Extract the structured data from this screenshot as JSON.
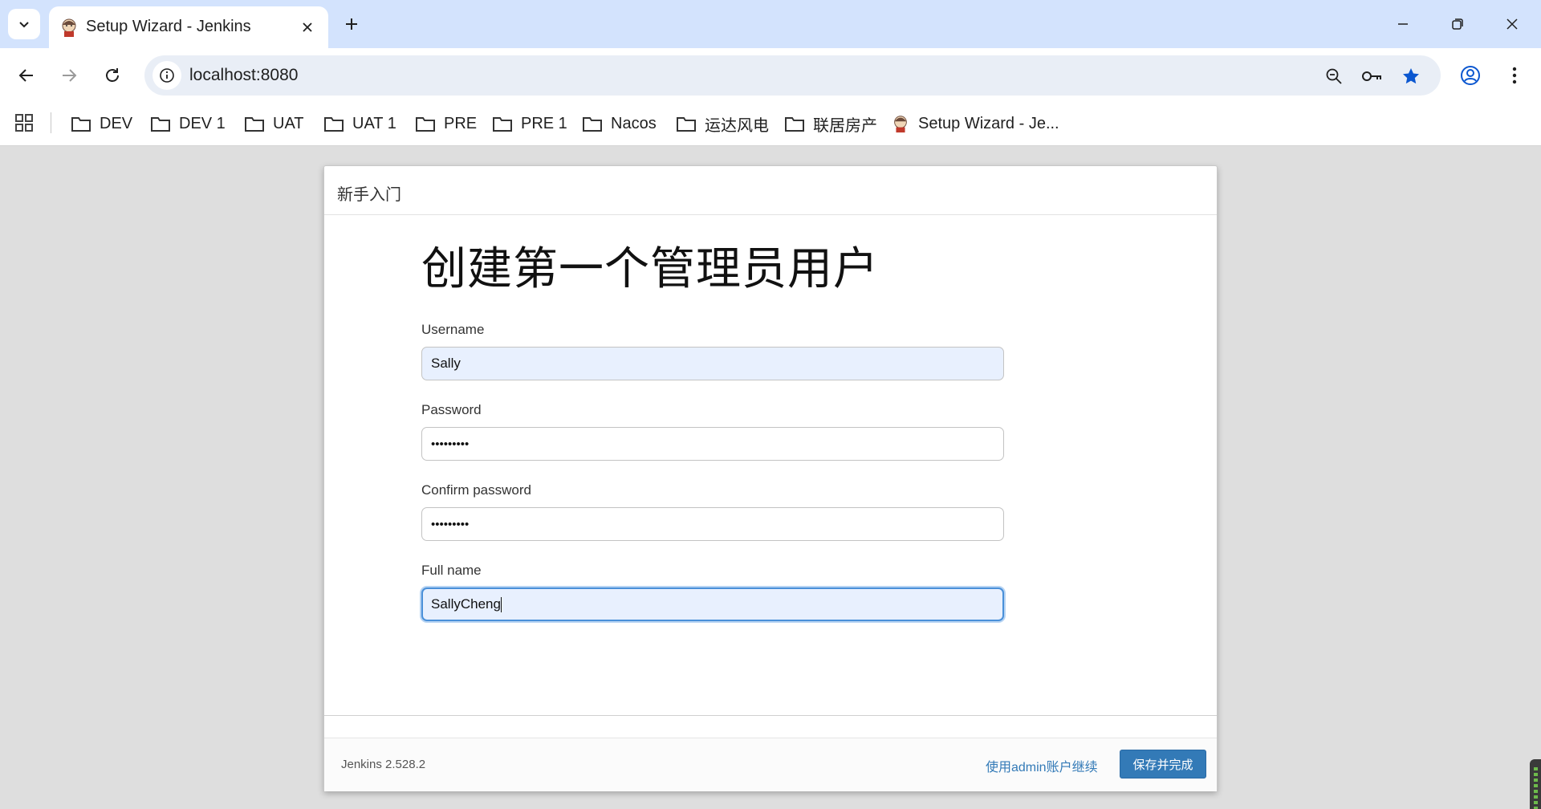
{
  "browser": {
    "tab": {
      "title": "Setup Wizard - Jenkins"
    },
    "address": {
      "url": "localhost:8080"
    },
    "bookmarks": [
      {
        "label": "DEV",
        "type": "folder"
      },
      {
        "label": "DEV 1",
        "type": "folder"
      },
      {
        "label": "UAT",
        "type": "folder"
      },
      {
        "label": "UAT 1",
        "type": "folder"
      },
      {
        "label": "PRE",
        "type": "folder"
      },
      {
        "label": "PRE 1",
        "type": "folder"
      },
      {
        "label": "Nacos",
        "type": "folder"
      },
      {
        "label": "运达风电",
        "type": "folder"
      },
      {
        "label": "联居房产",
        "type": "folder"
      },
      {
        "label": "Setup Wizard - Je...",
        "type": "page"
      }
    ],
    "accent_color": "#0b57d0"
  },
  "dialog": {
    "header": "新手入门",
    "title": "创建第一个管理员用户",
    "fields": {
      "username": {
        "label": "Username",
        "value": "Sally"
      },
      "password": {
        "label": "Password",
        "value": "•••••••••"
      },
      "confirm": {
        "label": "Confirm password",
        "value": "•••••••••"
      },
      "fullname": {
        "label": "Full name",
        "value": "SallyCheng"
      }
    },
    "footer": {
      "version": "Jenkins 2.528.2",
      "continue_admin": "使用admin账户继续",
      "save_finish": "保存并完成"
    },
    "primary_color": "#337ab7"
  }
}
